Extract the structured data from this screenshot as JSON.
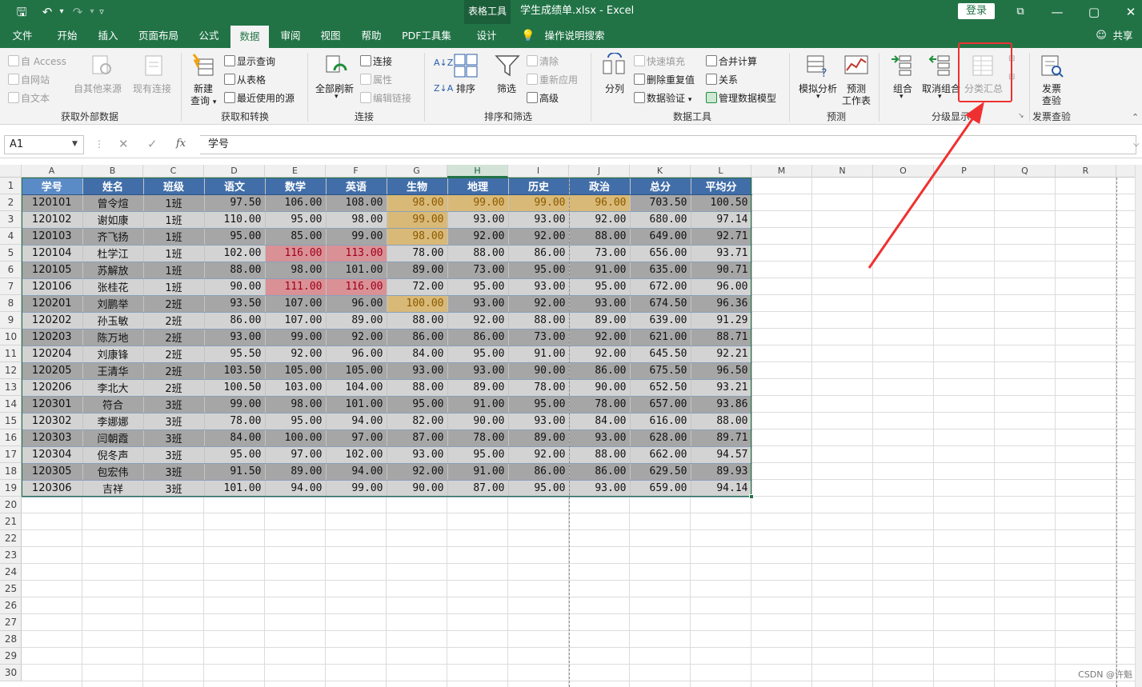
{
  "titlebar": {
    "context_tab": "表格工具",
    "title": "学生成绩单.xlsx  -  Excel",
    "login": "登录",
    "share": "共享",
    "icons": [
      "save-icon",
      "undo-icon",
      "redo-icon",
      "customize-icon"
    ]
  },
  "tabs": [
    "文件",
    "开始",
    "插入",
    "页面布局",
    "公式",
    "数据",
    "审阅",
    "视图",
    "帮助",
    "PDF工具集",
    "设计"
  ],
  "active_tab": "数据",
  "tell_me": "操作说明搜索",
  "ribbon": {
    "get_external": {
      "label": "获取外部数据",
      "access": "自 Access",
      "web": "自网站",
      "text": "自文本",
      "other": "自其他来源",
      "existing": "现有连接"
    },
    "get_transform": {
      "label": "获取和转换",
      "new_query_1": "新建",
      "new_query_2": "查询",
      "show_queries": "显示查询",
      "from_table": "从表格",
      "recent": "最近使用的源"
    },
    "connections": {
      "label": "连接",
      "refresh_all": "全部刷新",
      "connections": "连接",
      "properties": "属性",
      "edit_links": "编辑链接"
    },
    "sort_filter": {
      "label": "排序和筛选",
      "sort": "排序",
      "filter": "筛选",
      "clear": "清除",
      "reapply": "重新应用",
      "advanced": "高级"
    },
    "data_tools": {
      "label": "数据工具",
      "split": "分列",
      "flash_fill": "快速填充",
      "remove_dup": "删除重复值",
      "validation": "数据验证",
      "consolidate": "合并计算",
      "relations": "关系",
      "manage_model": "管理数据模型"
    },
    "forecast": {
      "label": "预测",
      "what_if": "模拟分析",
      "forecast_1": "预测",
      "forecast_2": "工作表"
    },
    "outline": {
      "label": "分级显示",
      "group": "组合",
      "ungroup": "取消组合",
      "subtotal": "分类汇总"
    },
    "invoice": {
      "label": "发票查验",
      "btn_1": "发票",
      "btn_2": "查验"
    }
  },
  "formula_bar": {
    "name_box": "A1",
    "formula": "学号"
  },
  "columns": [
    "A",
    "B",
    "C",
    "D",
    "E",
    "F",
    "G",
    "H",
    "I",
    "J",
    "K",
    "L",
    "M",
    "N",
    "O",
    "P",
    "Q",
    "R"
  ],
  "selected_column": "H",
  "rows": [
    "1",
    "2",
    "3",
    "4",
    "5",
    "6",
    "7",
    "8",
    "9",
    "10",
    "11",
    "12",
    "13",
    "14",
    "15",
    "16",
    "17",
    "18",
    "19",
    "20",
    "21",
    "22",
    "23",
    "24",
    "25",
    "26",
    "27",
    "28",
    "29",
    "30"
  ],
  "table": {
    "headers": [
      "学号",
      "姓名",
      "班级",
      "语文",
      "数学",
      "英语",
      "生物",
      "地理",
      "历史",
      "政治",
      "总分",
      "平均分"
    ],
    "data": [
      [
        "120101",
        "曾令煊",
        "1班",
        "97.50",
        "106.00",
        "108.00",
        "98.00",
        "99.00",
        "99.00",
        "96.00",
        "703.50",
        "100.50"
      ],
      [
        "120102",
        "谢如康",
        "1班",
        "110.00",
        "95.00",
        "98.00",
        "99.00",
        "93.00",
        "93.00",
        "92.00",
        "680.00",
        "97.14"
      ],
      [
        "120103",
        "齐飞扬",
        "1班",
        "95.00",
        "85.00",
        "99.00",
        "98.00",
        "92.00",
        "92.00",
        "88.00",
        "649.00",
        "92.71"
      ],
      [
        "120104",
        "杜学江",
        "1班",
        "102.00",
        "116.00",
        "113.00",
        "78.00",
        "88.00",
        "86.00",
        "73.00",
        "656.00",
        "93.71"
      ],
      [
        "120105",
        "苏解放",
        "1班",
        "88.00",
        "98.00",
        "101.00",
        "89.00",
        "73.00",
        "95.00",
        "91.00",
        "635.00",
        "90.71"
      ],
      [
        "120106",
        "张桂花",
        "1班",
        "90.00",
        "111.00",
        "116.00",
        "72.00",
        "95.00",
        "93.00",
        "95.00",
        "672.00",
        "96.00"
      ],
      [
        "120201",
        "刘鹏举",
        "2班",
        "93.50",
        "107.00",
        "96.00",
        "100.00",
        "93.00",
        "92.00",
        "93.00",
        "674.50",
        "96.36"
      ],
      [
        "120202",
        "孙玉敏",
        "2班",
        "86.00",
        "107.00",
        "89.00",
        "88.00",
        "92.00",
        "88.00",
        "89.00",
        "639.00",
        "91.29"
      ],
      [
        "120203",
        "陈万地",
        "2班",
        "93.00",
        "99.00",
        "92.00",
        "86.00",
        "86.00",
        "73.00",
        "92.00",
        "621.00",
        "88.71"
      ],
      [
        "120204",
        "刘康锋",
        "2班",
        "95.50",
        "92.00",
        "96.00",
        "84.00",
        "95.00",
        "91.00",
        "92.00",
        "645.50",
        "92.21"
      ],
      [
        "120205",
        "王清华",
        "2班",
        "103.50",
        "105.00",
        "105.00",
        "93.00",
        "93.00",
        "90.00",
        "86.00",
        "675.50",
        "96.50"
      ],
      [
        "120206",
        "李北大",
        "2班",
        "100.50",
        "103.00",
        "104.00",
        "88.00",
        "89.00",
        "78.00",
        "90.00",
        "652.50",
        "93.21"
      ],
      [
        "120301",
        "符合",
        "3班",
        "99.00",
        "98.00",
        "101.00",
        "95.00",
        "91.00",
        "95.00",
        "78.00",
        "657.00",
        "93.86"
      ],
      [
        "120302",
        "李娜娜",
        "3班",
        "78.00",
        "95.00",
        "94.00",
        "82.00",
        "90.00",
        "93.00",
        "84.00",
        "616.00",
        "88.00"
      ],
      [
        "120303",
        "闫朝霞",
        "3班",
        "84.00",
        "100.00",
        "97.00",
        "87.00",
        "78.00",
        "89.00",
        "93.00",
        "628.00",
        "89.71"
      ],
      [
        "120304",
        "倪冬声",
        "3班",
        "95.00",
        "97.00",
        "102.00",
        "93.00",
        "95.00",
        "92.00",
        "88.00",
        "662.00",
        "94.57"
      ],
      [
        "120305",
        "包宏伟",
        "3班",
        "91.50",
        "89.00",
        "94.00",
        "92.00",
        "91.00",
        "86.00",
        "86.00",
        "629.50",
        "89.93"
      ],
      [
        "120306",
        "吉祥",
        "3班",
        "101.00",
        "94.00",
        "99.00",
        "90.00",
        "87.00",
        "95.00",
        "93.00",
        "659.00",
        "94.14"
      ]
    ],
    "yellow_cells": [
      [
        0,
        6
      ],
      [
        0,
        7
      ],
      [
        0,
        8
      ],
      [
        0,
        9
      ],
      [
        1,
        6
      ],
      [
        2,
        6
      ],
      [
        6,
        6
      ]
    ],
    "red_cells": [
      [
        3,
        4
      ],
      [
        3,
        5
      ],
      [
        5,
        4
      ],
      [
        5,
        5
      ]
    ]
  },
  "watermark": "CSDN @许魁",
  "colors": {
    "excel_green": "#217346",
    "header_blue": "#416ea8",
    "highlight_red": "#f03030"
  }
}
